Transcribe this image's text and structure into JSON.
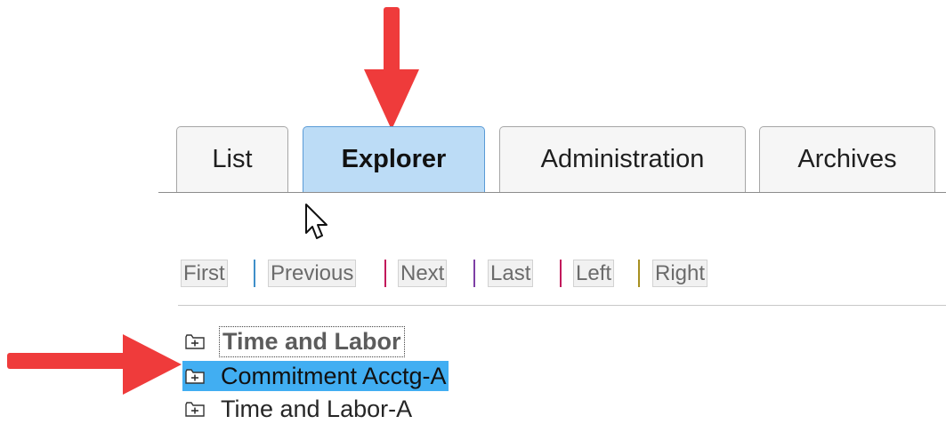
{
  "tabs": [
    {
      "label": "List",
      "active": false
    },
    {
      "label": "Explorer",
      "active": true
    },
    {
      "label": "Administration",
      "active": false
    },
    {
      "label": "Archives",
      "active": false
    }
  ],
  "pager": {
    "first": "First",
    "previous": "Previous",
    "next": "Next",
    "last": "Last",
    "left": "Left",
    "right": "Right"
  },
  "tree": {
    "items": [
      {
        "label": "Time and Labor",
        "icon": "folder-plus-icon",
        "focused": true,
        "selected": false
      },
      {
        "label": "Commitment Acctg-A",
        "icon": "folder-plus-icon",
        "focused": false,
        "selected": true
      },
      {
        "label": "Time and Labor-A",
        "icon": "folder-plus-icon",
        "focused": false,
        "selected": false
      }
    ]
  },
  "annotations": {
    "arrow_color": "#ef3b3b",
    "arrows": [
      "arrow-down-icon",
      "arrow-right-icon"
    ]
  },
  "colors": {
    "active_tab_bg": "#bcdcf6",
    "active_tab_border": "#5a9bd6",
    "selected_row_bg": "#41aef2"
  }
}
